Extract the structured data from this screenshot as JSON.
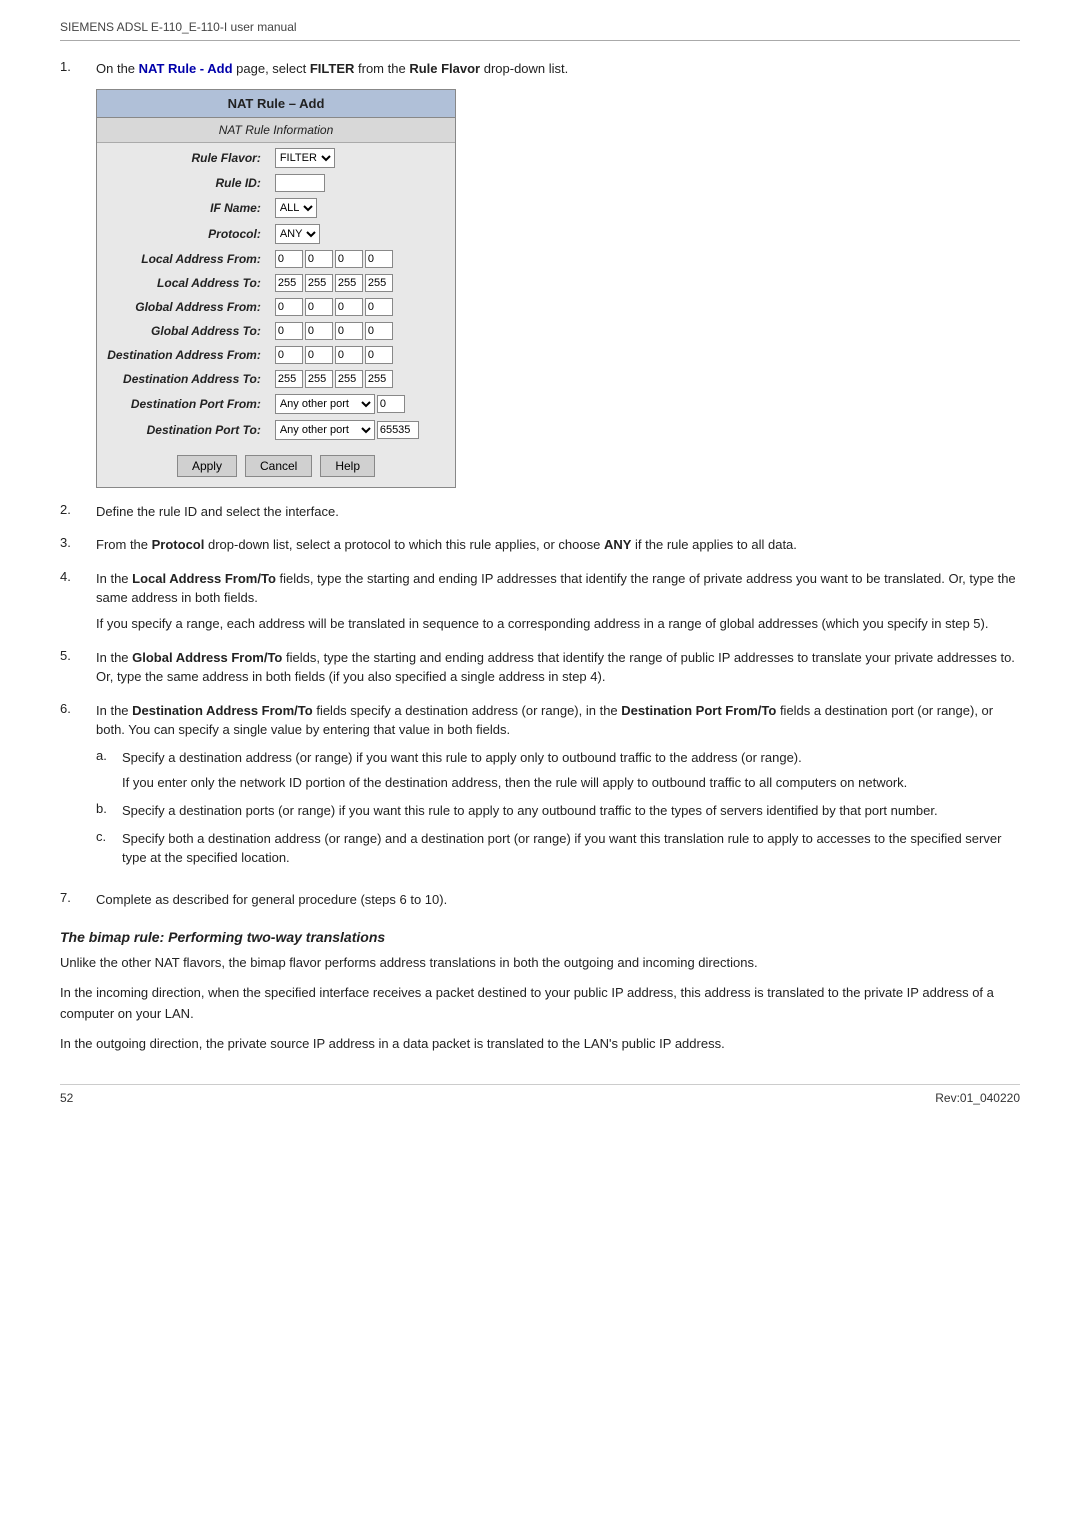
{
  "header": {
    "text": "SIEMENS ADSL E-110_E-110-I user manual"
  },
  "steps": [
    {
      "number": "1.",
      "text_before": "On the ",
      "link": "NAT Rule - Add",
      "text_after": " page, select ",
      "bold1": "FILTER",
      "text_after2": " from the ",
      "bold2": "Rule Flavor",
      "text_after3": " drop-down list."
    },
    {
      "number": "2.",
      "text": "Define the rule ID and select the interface."
    },
    {
      "number": "3.",
      "text_before": "From the ",
      "bold1": "Protocol",
      "text_after": " drop-down list, select a protocol to which this rule applies, or choose ",
      "bold2": "ANY",
      "text_after2": " if the rule applies to all data."
    },
    {
      "number": "4.",
      "text_before": "In the ",
      "bold1": "Local Address From/To",
      "text_after": " fields, type the starting and ending IP addresses that identify the range of private address you want to be translated. Or, type the same address in both fields.",
      "indent_text": "If you specify a range, each address will be translated in sequence to a corresponding address in a range of global addresses (which you specify in step 5)."
    },
    {
      "number": "5.",
      "text_before": "In the ",
      "bold1": "Global Address From/To",
      "text_after": " fields, type the starting and ending address that identify the range of public IP addresses to translate your private addresses to. Or, type the same address in both fields (if you also specified a single address in step 4)."
    },
    {
      "number": "6.",
      "text_before": "In the ",
      "bold1": "Destination Address From/To",
      "text_after": " fields specify a destination address (or range), in the ",
      "bold2": "Destination Port From/To",
      "text_after2": " fields a destination port (or range), or both. You can specify a single value by entering that value in both fields.",
      "sub_items": [
        {
          "letter": "a.",
          "text_before": "Specify a destination address (or range) if you want this rule to apply only to outbound traffic to the address (or range).",
          "indent_text": "If you enter only the network ID portion of the destination address, then the rule will apply to outbound traffic to all computers on network."
        },
        {
          "letter": "b.",
          "text": "Specify a destination ports (or range) if you want this rule to apply to any outbound traffic to the types of servers identified by that port number."
        },
        {
          "letter": "c.",
          "text": "Specify both a destination address (or range) and a destination port (or range) if you want this translation rule to apply to accesses to the specified server type at the specified location."
        }
      ]
    },
    {
      "number": "7.",
      "text": "Complete as described for general procedure (steps 6 to 10)."
    }
  ],
  "nat_box": {
    "title": "NAT Rule – Add",
    "section_title": "NAT Rule Information",
    "fields": [
      {
        "label": "Rule Flavor:",
        "type": "select",
        "value": "FILTER"
      },
      {
        "label": "Rule ID:",
        "type": "text",
        "value": ""
      },
      {
        "label": "IF Name:",
        "type": "select",
        "value": "ALL"
      },
      {
        "label": "Protocol:",
        "type": "select",
        "value": "ANY"
      },
      {
        "label": "Local Address From:",
        "type": "ip4",
        "values": [
          "0",
          "0",
          "0",
          "0"
        ]
      },
      {
        "label": "Local Address To:",
        "type": "ip4",
        "values": [
          "255",
          "255",
          "255",
          "255"
        ]
      },
      {
        "label": "Global Address From:",
        "type": "ip4",
        "values": [
          "0",
          "0",
          "0",
          "0"
        ]
      },
      {
        "label": "Global Address To:",
        "type": "ip4",
        "values": [
          "0",
          "0",
          "0",
          "0"
        ]
      },
      {
        "label": "Destination Address From:",
        "type": "ip4",
        "values": [
          "0",
          "0",
          "0",
          "0"
        ]
      },
      {
        "label": "Destination Address To:",
        "type": "ip4",
        "values": [
          "255",
          "255",
          "255",
          "255"
        ]
      },
      {
        "label": "Destination Port From:",
        "type": "port",
        "select": "Any other port",
        "value": "0"
      },
      {
        "label": "Destination Port To:",
        "type": "port",
        "select": "Any other port",
        "value": "65535"
      }
    ],
    "buttons": [
      "Apply",
      "Cancel",
      "Help"
    ]
  },
  "bimap_section": {
    "heading": "The bimap rule: Performing two-way translations",
    "paragraphs": [
      "Unlike the other NAT flavors, the bimap flavor performs address translations in both the outgoing and incoming directions.",
      "In the incoming direction, when the specified interface receives a packet destined to your public IP address, this address is translated to the private IP address of a computer on your LAN.",
      "In the outgoing direction, the private source IP address in a data packet is translated to the LAN's public IP address."
    ]
  },
  "footer": {
    "page": "52",
    "rev": "Rev:01_040220"
  }
}
